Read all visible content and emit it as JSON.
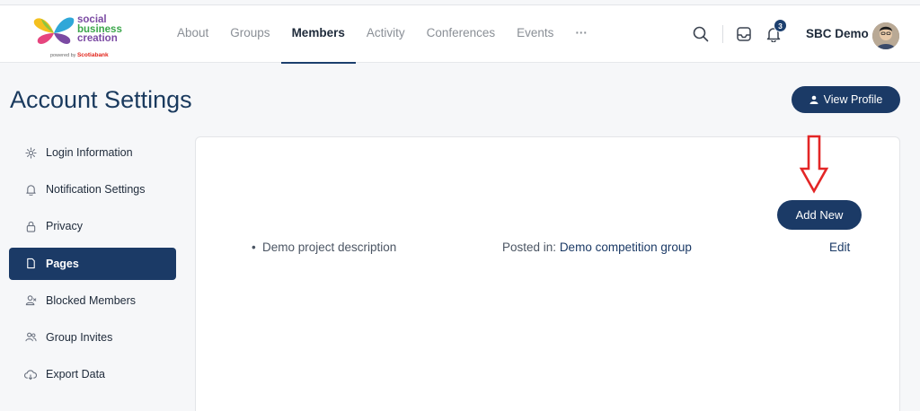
{
  "logo": {
    "line1": "social",
    "line2": "business",
    "line3": "creation",
    "powered_by": "powered by",
    "sponsor": "Scotiabank"
  },
  "nav": {
    "items": [
      {
        "label": "About"
      },
      {
        "label": "Groups"
      },
      {
        "label": "Members"
      },
      {
        "label": "Activity"
      },
      {
        "label": "Conferences"
      },
      {
        "label": "Events"
      },
      {
        "label": "···"
      }
    ],
    "active": "Members"
  },
  "header": {
    "notification_count": "3",
    "user_name": "SBC Demo",
    "icons": [
      "search-icon",
      "inbox-icon",
      "bell-icon",
      "avatar"
    ]
  },
  "page": {
    "title": "Account Settings",
    "view_profile_label": "View Profile"
  },
  "sidebar": {
    "items": [
      {
        "label": "Login Information",
        "icon": "gear-icon"
      },
      {
        "label": "Notification Settings",
        "icon": "bell-icon"
      },
      {
        "label": "Privacy",
        "icon": "lock-icon"
      },
      {
        "label": "Pages",
        "icon": "document-icon"
      },
      {
        "label": "Blocked Members",
        "icon": "user-blocked-icon"
      },
      {
        "label": "Group Invites",
        "icon": "users-icon"
      },
      {
        "label": "Export Data",
        "icon": "cloud-download-icon"
      }
    ],
    "active": "Pages"
  },
  "main": {
    "add_new_label": "Add New",
    "rows": [
      {
        "title": "Demo project description",
        "posted_in_label": "Posted in:",
        "posted_in_value": "Demo competition group",
        "edit_label": "Edit"
      }
    ]
  },
  "colors": {
    "primary": "#1b3a66",
    "text": "#1e2a3a",
    "muted": "#8a8f96",
    "annotation_arrow": "#e32626",
    "background": "#f6f7f9"
  }
}
